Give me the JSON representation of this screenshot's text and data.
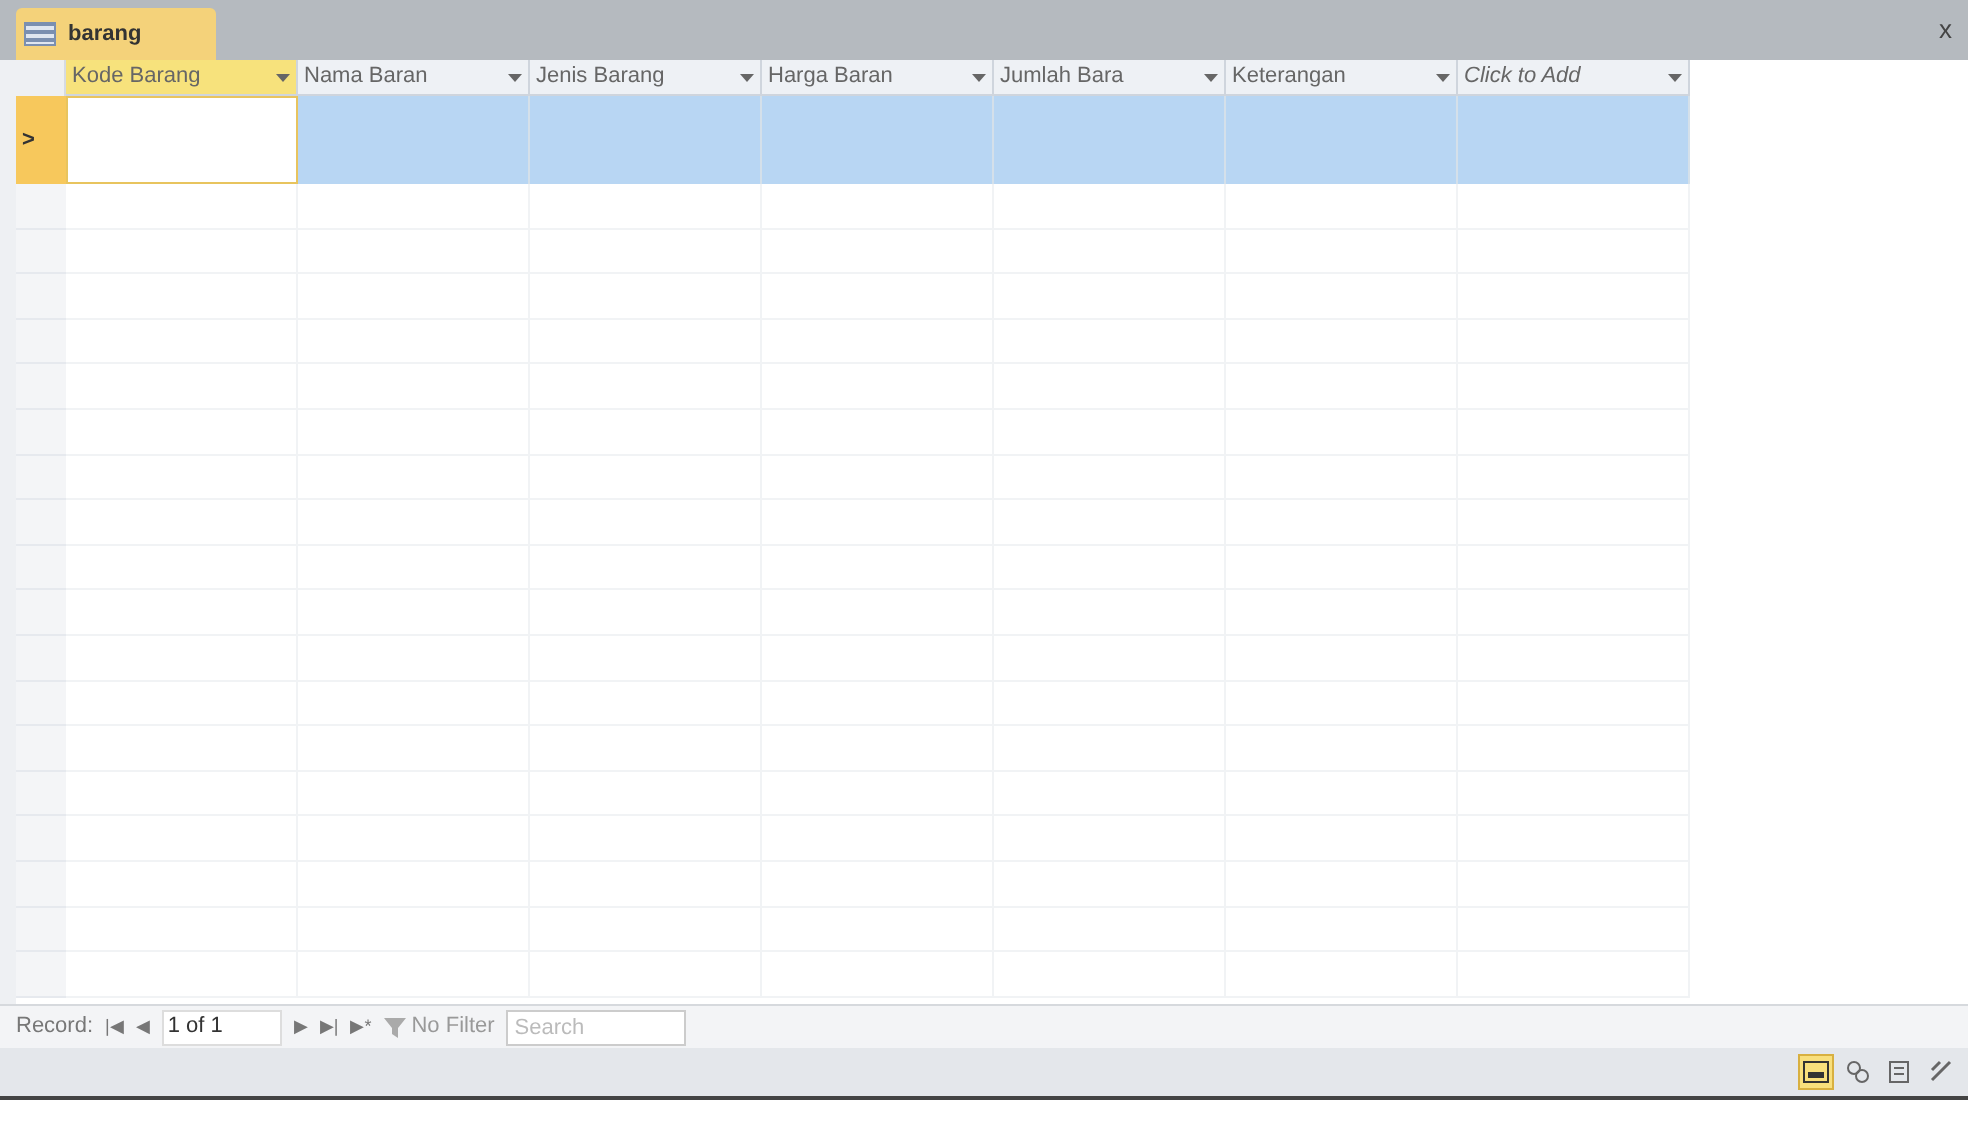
{
  "tab": {
    "label": "barang",
    "selected": true
  },
  "close": "x",
  "columns": [
    {
      "label": "Kode Barang",
      "selected": true
    },
    {
      "label": "Nama Baran",
      "selected": false
    },
    {
      "label": "Jenis Barang",
      "selected": false
    },
    {
      "label": "Harga Baran",
      "selected": false
    },
    {
      "label": "Jumlah Bara",
      "selected": false
    },
    {
      "label": "Keterangan",
      "selected": false
    },
    {
      "label": "Click to Add",
      "selected": false,
      "kind": "add"
    }
  ],
  "new_row": {
    "selector": ">",
    "selected": true
  },
  "navigation": {
    "label": "Record:",
    "first": "|◀",
    "prev": "◀",
    "position": "1 of 1",
    "next": "▶",
    "last": "▶|",
    "new": "▶*",
    "filter": "No Filter",
    "search_placeholder": "Search"
  },
  "views": [
    {
      "selected": true
    },
    {
      "selected": false
    },
    {
      "selected": false
    },
    {
      "selected": false
    }
  ]
}
